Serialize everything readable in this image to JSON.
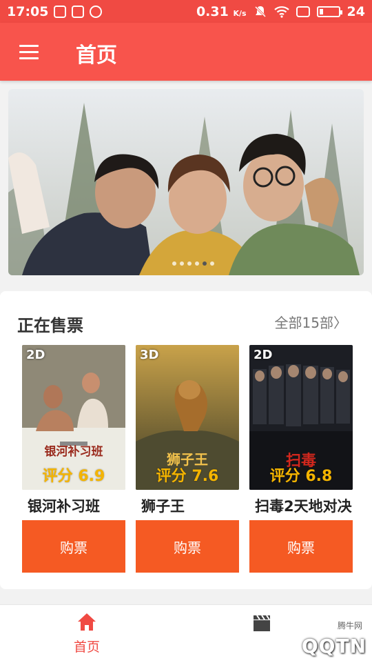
{
  "status_bar": {
    "time": "17:05",
    "speed": "0.31",
    "speed_unit": "K/s",
    "battery": "24"
  },
  "header": {
    "title": "首页",
    "menu_icon": "hamburger-menu-icon"
  },
  "banner": {
    "slide_count": 6,
    "active_slide": 5
  },
  "now_showing": {
    "title": "正在售票",
    "all_link": "全部15部〉",
    "movies": [
      {
        "dimension": "2D",
        "poster_title": "银河补习班",
        "score": "评分 6.9",
        "name": "银河补习班",
        "buy_label": "购票"
      },
      {
        "dimension": "3D",
        "poster_title": "狮子王",
        "score": "评分 7.6",
        "name": "狮子王",
        "buy_label": "购票"
      },
      {
        "dimension": "2D",
        "poster_title": "扫毒",
        "score": "评分 6.8",
        "name": "扫毒2天地对决",
        "buy_label": "购票"
      }
    ]
  },
  "bottom_nav": {
    "items": [
      {
        "label": "首页",
        "icon": "home-icon",
        "active": true
      },
      {
        "label": "",
        "icon": "clapperboard-icon",
        "active": false
      }
    ]
  },
  "watermark": {
    "main": "QQTN",
    "small": "腾牛网"
  },
  "colors": {
    "header": "#f8544c",
    "status_bar": "#f04a43",
    "buy_button": "#f55a23",
    "active_nav": "#f04a43"
  }
}
